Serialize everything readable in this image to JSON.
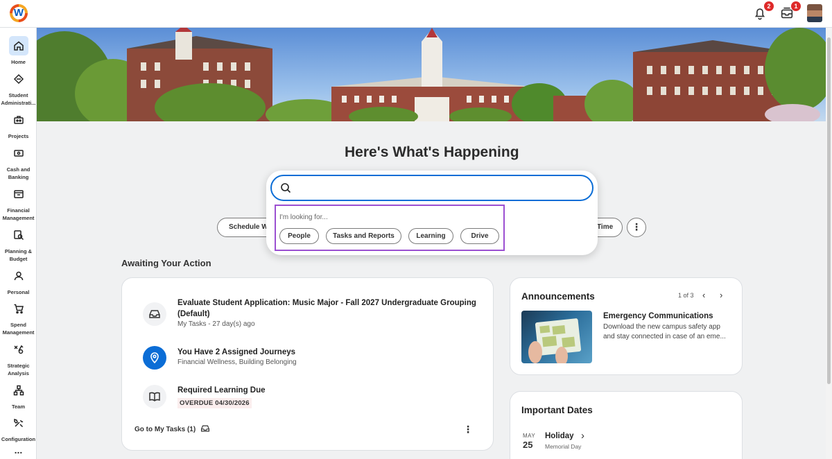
{
  "app": {
    "logo_letter": "W"
  },
  "header": {
    "notifications_badge": "2",
    "inbox_badge": "1"
  },
  "sidebar": {
    "items": [
      {
        "label": "Home",
        "icon": "home-icon"
      },
      {
        "label": "Student Administrati...",
        "icon": "student-admin-icon"
      },
      {
        "label": "Projects",
        "icon": "projects-icon"
      },
      {
        "label": "Cash and Banking",
        "icon": "cash-icon"
      },
      {
        "label": "Financial Management",
        "icon": "financial-icon"
      },
      {
        "label": "Planning & Budget",
        "icon": "planning-icon"
      },
      {
        "label": "Personal",
        "icon": "personal-icon"
      },
      {
        "label": "Spend Management",
        "icon": "spend-icon"
      },
      {
        "label": "Strategic Analysis",
        "icon": "strategic-icon"
      },
      {
        "label": "Team",
        "icon": "team-icon"
      },
      {
        "label": "Configuration",
        "icon": "configuration-icon"
      },
      {
        "label": "...",
        "icon": "more-icon"
      }
    ]
  },
  "main": {
    "heading": "Here's What's Happening",
    "quick_actions": {
      "left_partial": "Schedule W",
      "right_partial": "Time",
      "more": "⋮"
    }
  },
  "search": {
    "value": "",
    "looking_label": "I'm looking for...",
    "categories": [
      "People",
      "Tasks and Reports",
      "Learning",
      "Drive"
    ]
  },
  "awaiting": {
    "title": "Awaiting Your Action",
    "tasks": [
      {
        "title": "Evaluate Student Application: Music Major - Fall 2027 Undergraduate Grouping (Default)",
        "sub": "My Tasks - 27 day(s) ago"
      },
      {
        "title": "You Have 2 Assigned Journeys",
        "sub": "Financial Wellness, Building Belonging"
      },
      {
        "title": "Required Learning Due",
        "sub": "OVERDUE 04/30/2026"
      }
    ],
    "footer": "Go to My Tasks (1)"
  },
  "announcements": {
    "title": "Announcements",
    "pager": "1 of 3",
    "item_title": "Emergency Communications",
    "item_body": "Download the new campus safety app and stay connected in case of an eme..."
  },
  "dates": {
    "title": "Important Dates",
    "month": "MAY",
    "day": "25",
    "name": "Holiday",
    "desc": "Memorial Day"
  },
  "colors": {
    "accent": "#0b6dd6",
    "highlight_border": "#9b4fd1",
    "badge": "#de2a2a"
  }
}
